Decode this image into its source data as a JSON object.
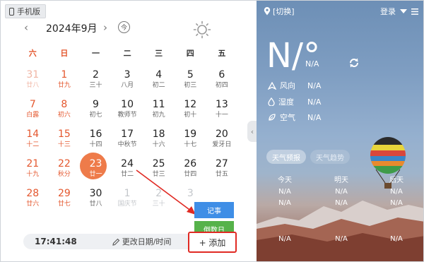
{
  "mobile_button": "手机版",
  "nav": {
    "prev": "‹",
    "month": "2024年9月",
    "next": "›",
    "today": "今"
  },
  "weekdays": [
    "六",
    "日",
    "一",
    "二",
    "三",
    "四",
    "五"
  ],
  "weeks": [
    [
      {
        "d": "31",
        "l": "廿八"
      },
      {
        "d": "1",
        "l": "廿九"
      },
      {
        "d": "2",
        "l": "三十"
      },
      {
        "d": "3",
        "l": "八月"
      },
      {
        "d": "4",
        "l": "初二"
      },
      {
        "d": "5",
        "l": "初三"
      },
      {
        "d": "6",
        "l": "初四"
      }
    ],
    [
      {
        "d": "7",
        "l": "白露"
      },
      {
        "d": "8",
        "l": "初六"
      },
      {
        "d": "9",
        "l": "初七"
      },
      {
        "d": "10",
        "l": "教师节"
      },
      {
        "d": "11",
        "l": "初九"
      },
      {
        "d": "12",
        "l": "初十"
      },
      {
        "d": "13",
        "l": "十一"
      }
    ],
    [
      {
        "d": "14",
        "l": "十二"
      },
      {
        "d": "15",
        "l": "十三"
      },
      {
        "d": "16",
        "l": "十四"
      },
      {
        "d": "17",
        "l": "中秋节"
      },
      {
        "d": "18",
        "l": "十六"
      },
      {
        "d": "19",
        "l": "十七"
      },
      {
        "d": "20",
        "l": "爱牙日"
      }
    ],
    [
      {
        "d": "21",
        "l": "十九"
      },
      {
        "d": "22",
        "l": "秋分"
      },
      {
        "d": "23",
        "l": "廿一"
      },
      {
        "d": "24",
        "l": "廿二"
      },
      {
        "d": "25",
        "l": "廿三"
      },
      {
        "d": "26",
        "l": "廿四"
      },
      {
        "d": "27",
        "l": "廿五"
      }
    ],
    [
      {
        "d": "28",
        "l": "廿六"
      },
      {
        "d": "29",
        "l": "廿七"
      },
      {
        "d": "30",
        "l": "廿八"
      },
      {
        "d": "1",
        "l": "国庆节"
      },
      {
        "d": "2",
        "l": "三十"
      },
      {
        "d": "3",
        "l": ""
      },
      {
        "d": "",
        "l": ""
      }
    ]
  ],
  "bottom": {
    "time": "17:41:48",
    "edit_label": "更改日期/时间"
  },
  "popup": {
    "jishi": "记事",
    "daoshu": "倒数日"
  },
  "add_button": "+ 添加",
  "weather": {
    "location": "[切换]",
    "login": "登录",
    "temp": "N/°",
    "temp_sub": "N/A",
    "wind_label": "风向",
    "wind_value": "N/A",
    "humidity_label": "湿度",
    "humidity_value": "N/A",
    "air_label": "空气",
    "air_value": "N/A",
    "tab_forecast": "天气预报",
    "tab_trend": "天气趋势",
    "days": [
      {
        "name": "今天",
        "v1": "N/A",
        "v2": "N/A",
        "v3": "N/A"
      },
      {
        "name": "明天",
        "v1": "N/A",
        "v2": "N/A",
        "v3": "N/A"
      },
      {
        "name": "后天",
        "v1": "N/A",
        "v2": "N/A",
        "v3": "N/A"
      }
    ]
  }
}
